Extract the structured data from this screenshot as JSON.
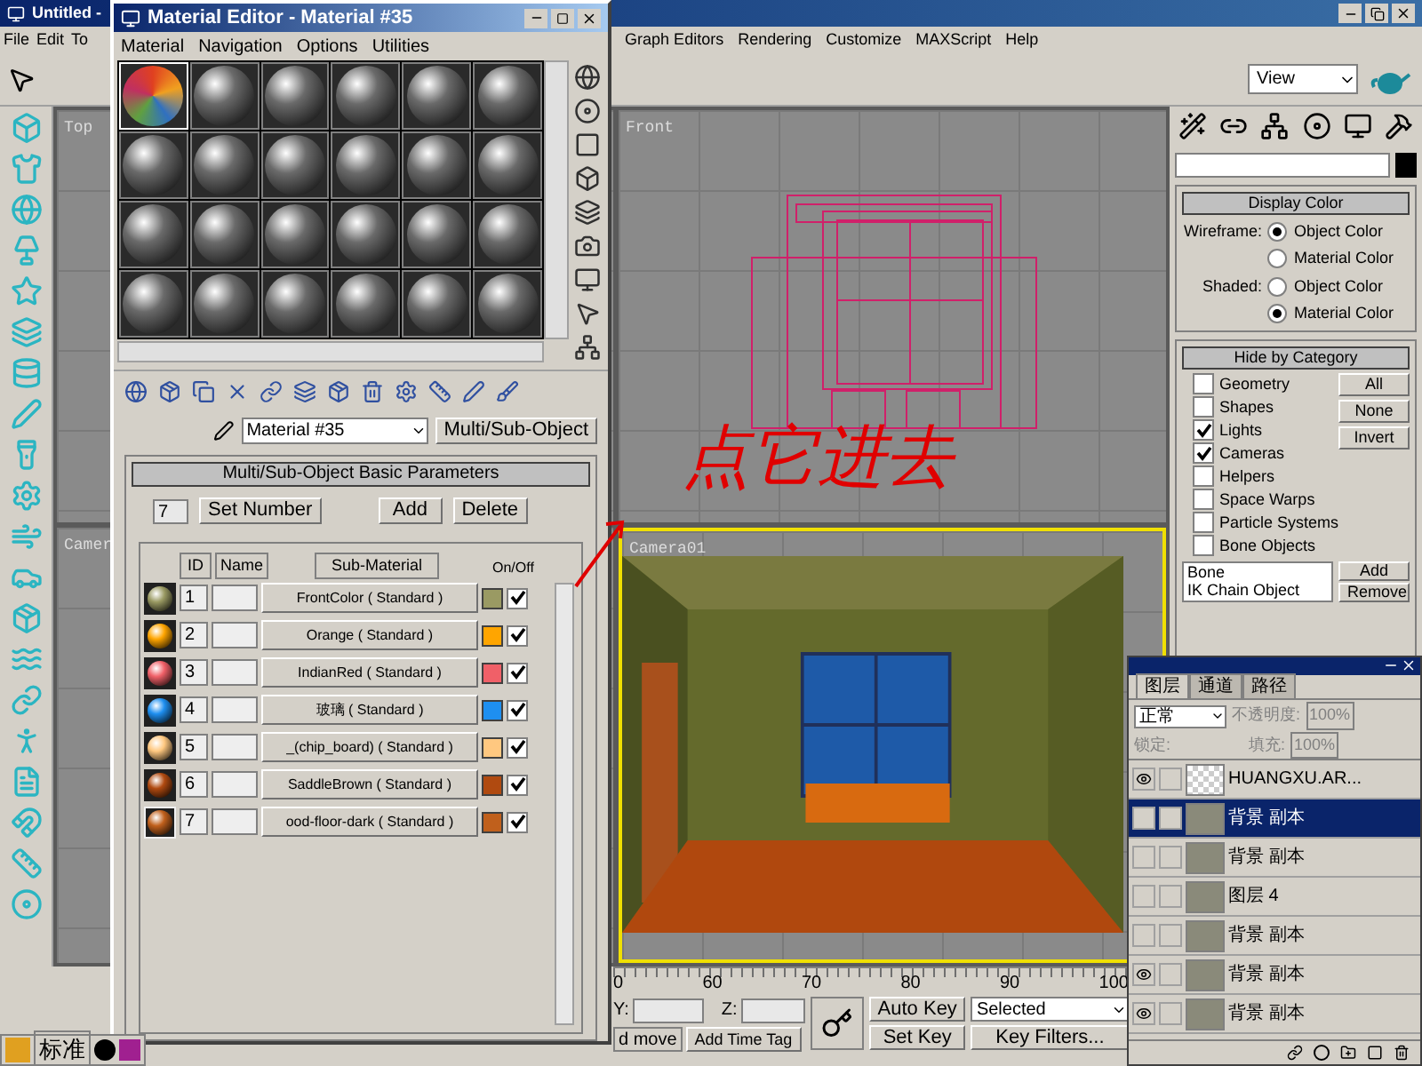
{
  "max_window": {
    "title": "Untitled -",
    "menu": [
      "File",
      "Edit",
      "To",
      "Graph Editors",
      "Rendering",
      "Customize",
      "MAXScript",
      "Help"
    ],
    "view_dropdown": "View"
  },
  "viewports": [
    {
      "label": "Top"
    },
    {
      "label": "Front"
    },
    {
      "label": "Camer"
    },
    {
      "label": "Camera01"
    }
  ],
  "command_panel": {
    "display_color": {
      "title": "Display Color",
      "groups": [
        {
          "label": "Wireframe:",
          "options": [
            {
              "label": "Object Color",
              "selected": true
            },
            {
              "label": "Material Color",
              "selected": false
            }
          ]
        },
        {
          "label": "Shaded:",
          "options": [
            {
              "label": "Object Color",
              "selected": false
            },
            {
              "label": "Material Color",
              "selected": true
            }
          ]
        }
      ]
    },
    "hide_by_category": {
      "title": "Hide by Category",
      "items": [
        {
          "label": "Geometry",
          "checked": false
        },
        {
          "label": "Shapes",
          "checked": false
        },
        {
          "label": "Lights",
          "checked": true
        },
        {
          "label": "Cameras",
          "checked": true
        },
        {
          "label": "Helpers",
          "checked": false
        },
        {
          "label": "Space Warps",
          "checked": false
        },
        {
          "label": "Particle Systems",
          "checked": false
        },
        {
          "label": "Bone Objects",
          "checked": false
        }
      ],
      "buttons": [
        "All",
        "None",
        "Invert"
      ],
      "list": [
        "Bone",
        "IK Chain Object"
      ],
      "list_buttons": [
        "Add",
        "Remove"
      ]
    }
  },
  "timeline": {
    "ticks": [
      "0",
      "60",
      "70",
      "80",
      "90",
      "100"
    ]
  },
  "bottom_bar": {
    "y_label": "Y:",
    "z_label": "Z:",
    "auto_key": "Auto Key",
    "set_key": "Set Key",
    "key_mode": "Selected",
    "key_filters": "Key Filters...",
    "prompt": "d move",
    "time_tag": "Add Time Tag"
  },
  "material_editor": {
    "title": "Material Editor - Material #35",
    "menu": [
      "Material",
      "Navigation",
      "Options",
      "Utilities"
    ],
    "sample_slots": [
      {
        "kind": "multi",
        "selected": true
      },
      {
        "kind": "standard",
        "selected": false
      },
      {
        "kind": "standard",
        "selected": false
      },
      {
        "kind": "standard",
        "selected": false
      },
      {
        "kind": "standard",
        "selected": false
      },
      {
        "kind": "standard",
        "selected": false
      },
      {
        "kind": "standard",
        "selected": false
      },
      {
        "kind": "standard",
        "selected": false
      },
      {
        "kind": "standard",
        "selected": false
      },
      {
        "kind": "standard",
        "selected": false
      },
      {
        "kind": "standard",
        "selected": false
      },
      {
        "kind": "standard",
        "selected": false
      },
      {
        "kind": "standard",
        "selected": false
      },
      {
        "kind": "standard",
        "selected": false
      },
      {
        "kind": "standard",
        "selected": false
      },
      {
        "kind": "standard",
        "selected": false
      },
      {
        "kind": "standard",
        "selected": false
      },
      {
        "kind": "standard",
        "selected": false
      },
      {
        "kind": "standard",
        "selected": false
      },
      {
        "kind": "standard",
        "selected": false
      },
      {
        "kind": "standard",
        "selected": false
      },
      {
        "kind": "standard",
        "selected": false
      },
      {
        "kind": "standard",
        "selected": false
      },
      {
        "kind": "standard",
        "selected": false
      }
    ],
    "material_name": "Material #35",
    "material_type": "Multi/Sub-Object",
    "rollout": {
      "title": "Multi/Sub-Object Basic Parameters",
      "count": "7",
      "buttons": [
        "Set Number",
        "Add",
        "Delete"
      ],
      "columns": [
        "ID",
        "Name",
        "Sub-Material",
        "On/Off"
      ],
      "rows": [
        {
          "id": "1",
          "sub_material": "FrontColor ( Standard )",
          "color": "#9a9a63",
          "on": true,
          "selected": false
        },
        {
          "id": "2",
          "sub_material": "Orange ( Standard )",
          "color": "#ffa500",
          "on": true,
          "selected": false
        },
        {
          "id": "3",
          "sub_material": "IndianRed ( Standard )",
          "color": "#f06068",
          "on": true,
          "selected": false
        },
        {
          "id": "4",
          "sub_material": "玻璃 ( Standard )",
          "color": "#1e8ff0",
          "on": true,
          "selected": false
        },
        {
          "id": "5",
          "sub_material": "_(chip_board) ( Standard )",
          "color": "#ffc880",
          "on": true,
          "selected": false
        },
        {
          "id": "6",
          "sub_material": "SaddleBrown ( Standard )",
          "color": "#b04a10",
          "on": true,
          "selected": false
        },
        {
          "id": "7",
          "sub_material": "ood-floor-dark ( Standard )",
          "color": "#c0601c",
          "on": true,
          "selected": true
        }
      ]
    }
  },
  "layers_palette": {
    "tabs": [
      {
        "label": "图层",
        "selected": true
      },
      {
        "label": "通道",
        "selected": false
      },
      {
        "label": "路径",
        "selected": false
      }
    ],
    "blend_mode": "正常",
    "opacity_label": "不透明度:",
    "opacity": "100%",
    "lock_label": "锁定:",
    "fill_label": "填充:",
    "fill": "100%",
    "layers": [
      {
        "name": "HUANGXU.AR...",
        "visible": true,
        "selected": false,
        "kind": "text"
      },
      {
        "name": "背景 副本",
        "visible": false,
        "selected": true,
        "kind": "image"
      },
      {
        "name": "背景 副本",
        "visible": false,
        "selected": false,
        "kind": "image"
      },
      {
        "name": "图层 4",
        "visible": false,
        "selected": false,
        "kind": "image"
      },
      {
        "name": "背景 副本",
        "visible": false,
        "selected": false,
        "kind": "image"
      },
      {
        "name": "背景 副本",
        "visible": true,
        "selected": false,
        "kind": "image"
      },
      {
        "name": "背景 副本",
        "visible": true,
        "selected": false,
        "kind": "image"
      }
    ]
  },
  "ime_bar": {
    "mode": "标准"
  },
  "annotation": {
    "text": "点它进去"
  }
}
